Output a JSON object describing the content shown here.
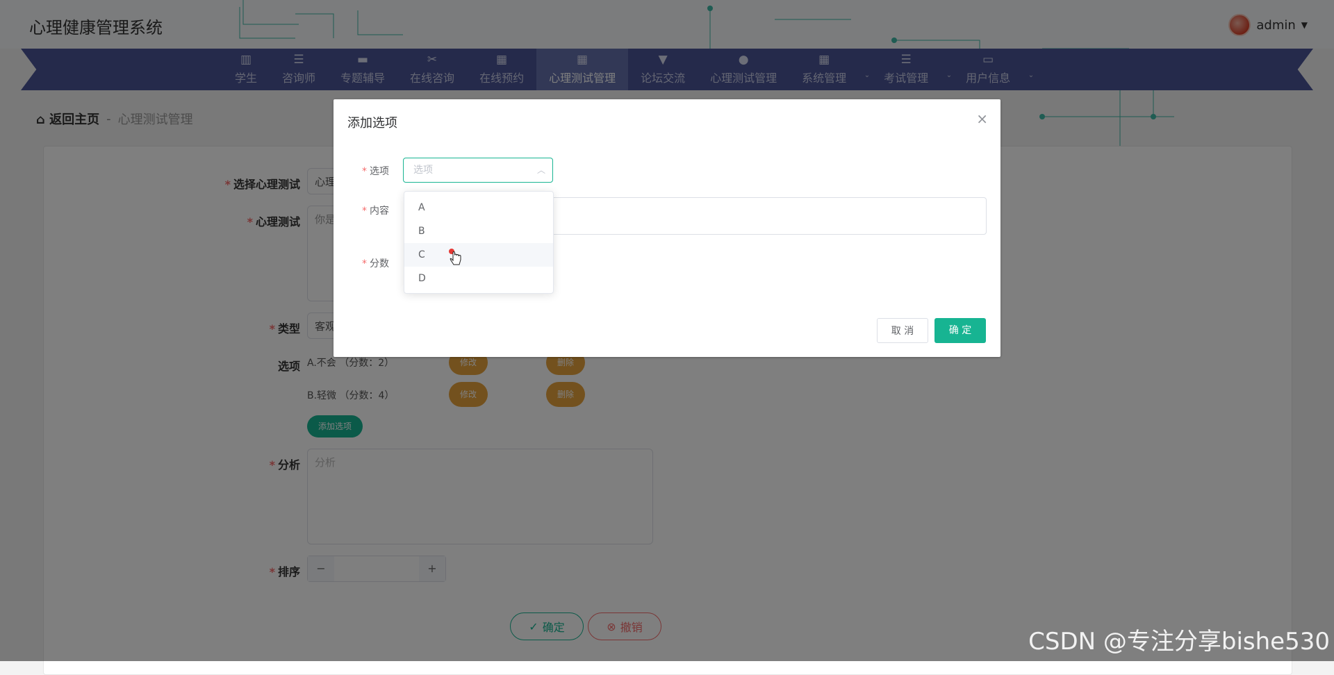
{
  "app": {
    "title": "心理健康管理系统"
  },
  "user": {
    "name": "admin"
  },
  "nav": [
    {
      "label": "学生",
      "icon": "bar-chart-icon"
    },
    {
      "label": "咨询师",
      "icon": "list-icon"
    },
    {
      "label": "专题辅导",
      "icon": "monitor-icon"
    },
    {
      "label": "在线咨询",
      "icon": "ticket-icon"
    },
    {
      "label": "在线预约",
      "icon": "grid-icon"
    },
    {
      "label": "心理测试管理",
      "icon": "grid-icon",
      "active": true
    },
    {
      "label": "论坛交流",
      "icon": "brush-icon"
    },
    {
      "label": "心理测试管理",
      "icon": "bulb-icon"
    },
    {
      "label": "系统管理",
      "icon": "grid-icon",
      "dropdown": true
    },
    {
      "label": "考试管理",
      "icon": "list-icon",
      "dropdown": true
    },
    {
      "label": "用户信息",
      "icon": "card-icon",
      "dropdown": true
    }
  ],
  "breadcrumb": {
    "home": "返回主页",
    "separator": "-",
    "current": "心理测试管理"
  },
  "form": {
    "select_test_label": "选择心理测试",
    "select_test_value": "心理",
    "test_label": "心理测试",
    "test_value": "你是",
    "type_label": "类型",
    "type_value": "客观",
    "options_label": "选项",
    "options": [
      {
        "text": "A.不会 （分数：2）",
        "edit": "修改",
        "delete": "删除"
      },
      {
        "text": "B.轻微 （分数：4）",
        "edit": "修改",
        "delete": "删除"
      }
    ],
    "add_option_label": "添加选项",
    "analysis_label": "分析",
    "analysis_placeholder": "分析",
    "sort_label": "排序",
    "sort_minus": "−",
    "sort_plus": "+",
    "confirm_label": "确定",
    "cancel_label": "撤销"
  },
  "dialog": {
    "title": "添加选项",
    "option_label": "选项",
    "option_placeholder": "选项",
    "content_label": "内容",
    "score_label": "分数",
    "cancel_label": "取 消",
    "confirm_label": "确 定",
    "dropdown_options": [
      "A",
      "B",
      "C",
      "D"
    ],
    "hovered_option": "C"
  },
  "watermark": "CSDN @专注分享bishe530",
  "colors": {
    "nav_bg": "#4a5596",
    "nav_active": "#6470ad",
    "primary": "#17b492",
    "warning": "#e6a23c",
    "danger": "#f56c6c"
  }
}
